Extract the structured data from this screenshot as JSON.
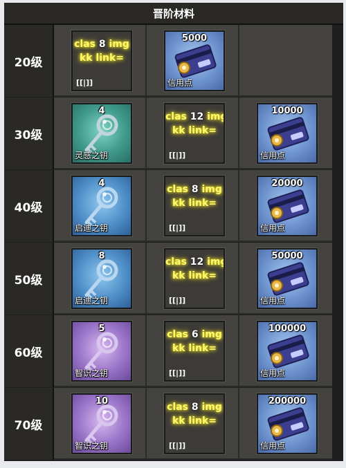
{
  "header": {
    "title": "晋阶材料"
  },
  "rows": [
    {
      "level": "20级",
      "items": [
        {
          "kind": "broken",
          "count": "8",
          "line1": "clas",
          "line1b": "img",
          "line2": "kk link=",
          "bracket": "[[|]]"
        },
        {
          "kind": "credit",
          "count": "5000",
          "name": "信用点"
        },
        {
          "kind": "empty"
        }
      ]
    },
    {
      "level": "30级",
      "items": [
        {
          "kind": "teal",
          "count": "4",
          "name": "灵感之钥"
        },
        {
          "kind": "broken",
          "count": "12",
          "line1": "clas",
          "line1b": "img",
          "line2": "kk link=",
          "bracket": "[[|]]"
        },
        {
          "kind": "credit",
          "count": "10000",
          "name": "信用点"
        }
      ]
    },
    {
      "level": "40级",
      "items": [
        {
          "kind": "blue",
          "count": "4",
          "name": "启迪之钥"
        },
        {
          "kind": "broken",
          "count": "8",
          "line1": "clas",
          "line1b": "img",
          "line2": "kk link=",
          "bracket": "[[|]]"
        },
        {
          "kind": "credit",
          "count": "20000",
          "name": "信用点"
        }
      ]
    },
    {
      "level": "50级",
      "items": [
        {
          "kind": "blue",
          "count": "8",
          "name": "启迪之钥"
        },
        {
          "kind": "broken",
          "count": "12",
          "line1": "clas",
          "line1b": "img",
          "line2": "kk link=",
          "bracket": "[[|]]"
        },
        {
          "kind": "credit",
          "count": "50000",
          "name": "信用点"
        }
      ]
    },
    {
      "level": "60级",
      "items": [
        {
          "kind": "purple",
          "count": "5",
          "name": "智识之钥"
        },
        {
          "kind": "broken",
          "count": "6",
          "line1": "clas",
          "line1b": "img",
          "line2": "kk link=",
          "bracket": "[[|]]"
        },
        {
          "kind": "credit",
          "count": "100000",
          "name": "信用点"
        }
      ]
    },
    {
      "level": "70级",
      "items": [
        {
          "kind": "purple",
          "count": "10",
          "name": "智识之钥"
        },
        {
          "kind": "broken",
          "count": "8",
          "line1": "clas",
          "line1b": "img",
          "line2": "kk link=",
          "bracket": "[[|]]"
        },
        {
          "kind": "credit",
          "count": "200000",
          "name": "信用点"
        }
      ]
    }
  ]
}
